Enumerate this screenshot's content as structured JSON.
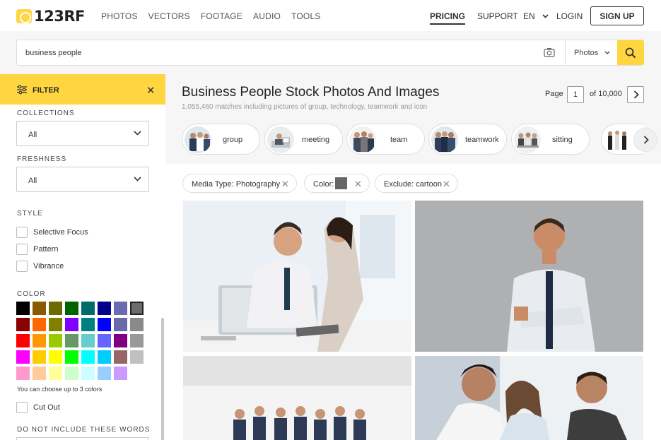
{
  "brand": {
    "name": "123RF",
    "accent": "#ffd640"
  },
  "nav": {
    "items": [
      "PHOTOS",
      "VECTORS",
      "FOOTAGE",
      "AUDIO",
      "TOOLS"
    ],
    "pricing": "PRICING",
    "support": "SUPPORT",
    "lang": "EN",
    "login": "LOGIN",
    "signup": "SIGN UP"
  },
  "search": {
    "query": "business people",
    "type": "Photos"
  },
  "sidebar": {
    "filter_label": "FILTER",
    "collections_label": "COLLECTIONS",
    "collections_value": "All",
    "freshness_label": "FRESHNESS",
    "freshness_value": "All",
    "style_label": "STYLE",
    "style_options": [
      "Selective Focus",
      "Pattern",
      "Vibrance"
    ],
    "color_label": "COLOR",
    "colors": [
      "#000000",
      "#8b5a00",
      "#6b6b00",
      "#006400",
      "#006b6b",
      "#00008b",
      "#6b6baf",
      "#6b6b6b",
      "#8b0000",
      "#ff6600",
      "#808000",
      "#8000ff",
      "#008080",
      "#0000ff",
      "#6a6aa8",
      "#8a8a8a",
      "#ff0000",
      "#ff9900",
      "#99cc00",
      "#669966",
      "#66cccc",
      "#6666ff",
      "#800080",
      "#999999",
      "#ff00ff",
      "#ffcc00",
      "#ffff00",
      "#00ff00",
      "#00ffff",
      "#00ccff",
      "#996666",
      "#c0c0c0",
      "#ff99cc",
      "#ffcc99",
      "#ffff99",
      "#ccffcc",
      "#ccffff",
      "#99ccff",
      "#cc99ff",
      "#ffffff"
    ],
    "color_note": "You can choose up to 3 colors",
    "cutout_label": "Cut Out",
    "exclude_label": "DO NOT INCLUDE THESE WORDS"
  },
  "main": {
    "title": "Business People Stock Photos And Images",
    "subtitle": "1,055,460 matches including pictures of group, technology, teamwork and icon",
    "page_label": "Page",
    "page_value": "1",
    "page_of": "of 10,000",
    "related": [
      "group",
      "meeting",
      "team",
      "teamwork",
      "sitting"
    ],
    "tags": {
      "media": "Media Type: Photography",
      "color": "Color:",
      "exclude": "Exclude: cartoon"
    }
  }
}
